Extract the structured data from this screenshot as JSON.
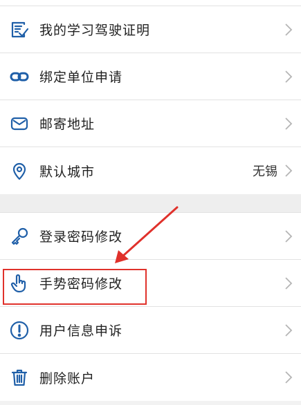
{
  "accent_color": "#1f5fa8",
  "highlight_color": "#e0312b",
  "group1": [
    {
      "label": "我的学习驾驶证明",
      "icon": "document-check-icon"
    },
    {
      "label": "绑定单位申请",
      "icon": "link-icon"
    },
    {
      "label": "邮寄地址",
      "icon": "mail-icon"
    },
    {
      "label": "默认城市",
      "icon": "location-pin-icon",
      "value": "无锡"
    }
  ],
  "group2": [
    {
      "label": "登录密码修改",
      "icon": "key-icon"
    },
    {
      "label": "手势密码修改",
      "icon": "hand-pointer-icon"
    },
    {
      "label": "用户信息申诉",
      "icon": "exclamation-circle-icon"
    },
    {
      "label": "删除账户",
      "icon": "trash-icon"
    }
  ]
}
